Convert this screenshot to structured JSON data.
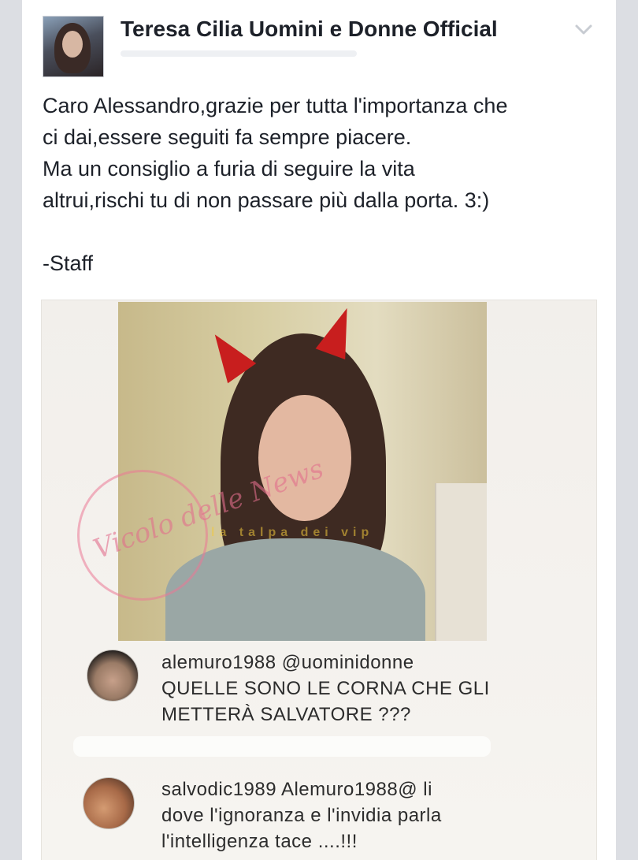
{
  "post": {
    "page_name": "Teresa Cilia Uomini e Donne Official",
    "text_lines": [
      "Caro Alessandro,grazie per tutta l'importanza che",
      "ci dai,essere seguiti fa sempre piacere.",
      "Ma un consiglio a furia di seguire la vita",
      "altrui,rischi tu di non passare più dalla porta. 3:)"
    ],
    "signature": "-Staff"
  },
  "image": {
    "watermark_logo": "Vicolo delle News",
    "watermark_2": "la talpa dei vip",
    "comments": [
      {
        "user": "alemuro1988",
        "mention": "@uominidonne",
        "lines": [
          "QUELLE SONO LE CORNA CHE GLI",
          "METTERÀ SALVATORE ???"
        ]
      },
      {
        "user": "salvodic1989",
        "mention": "Alemuro1988@",
        "lines_first_suffix": " li",
        "lines": [
          "dove l'ignoranza e l'invidia parla",
          "l'intelligenza tace ....!!!"
        ]
      }
    ]
  },
  "icons": {
    "chevron": "chevron-down-icon"
  }
}
